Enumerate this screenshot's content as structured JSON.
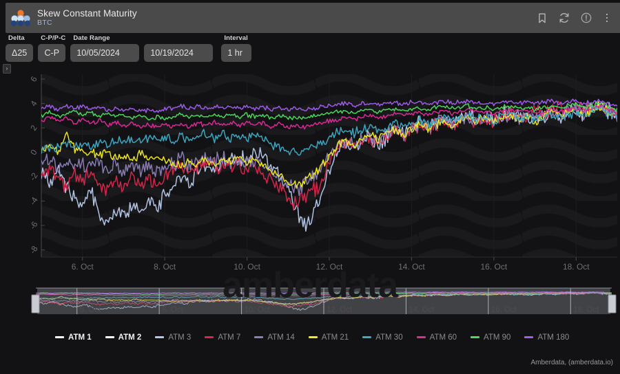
{
  "header": {
    "title": "Skew Constant Maturity",
    "subtitle": "BTC",
    "logo_icon": "amberdata-molecule-logo",
    "icons": [
      {
        "name": "bookmark-icon",
        "label": "Bookmark"
      },
      {
        "name": "refresh-icon",
        "label": "Refresh"
      },
      {
        "name": "info-icon",
        "label": "Info"
      },
      {
        "name": "kebab-menu-icon",
        "label": "More options"
      }
    ]
  },
  "controls": {
    "delta": {
      "label": "Delta",
      "value": "Δ25"
    },
    "cp": {
      "label": "C-P/P-C",
      "value": "C-P"
    },
    "date_range": {
      "label": "Date Range",
      "start": "10/05/2024",
      "end": "10/19/2024"
    },
    "interval": {
      "label": "Interval",
      "value": "1 hr"
    },
    "collapse_glyph": "›"
  },
  "credit": "Amberdata, (amberdata.io)",
  "watermark": "amberdata",
  "legend": [
    {
      "label": "ATM 1",
      "color": "#ffffff",
      "visible": false
    },
    {
      "label": "ATM 2",
      "color": "#ffffff",
      "visible": false
    },
    {
      "label": "ATM 3",
      "color": "#b7c8ea",
      "visible": true
    },
    {
      "label": "ATM 7",
      "color": "#d9264b",
      "visible": true
    },
    {
      "label": "ATM 14",
      "color": "#8c7fb8",
      "visible": true
    },
    {
      "label": "ATM 21",
      "color": "#f2ea1e",
      "visible": true
    },
    {
      "label": "ATM 30",
      "color": "#3fa9c4",
      "visible": true
    },
    {
      "label": "ATM 60",
      "color": "#e0299a",
      "visible": true
    },
    {
      "label": "ATM 90",
      "color": "#4ddb5e",
      "visible": true
    },
    {
      "label": "ATM 180",
      "color": "#a15df0",
      "visible": true
    }
  ],
  "chart_data": {
    "type": "line",
    "title": "Skew Constant Maturity",
    "subtitle": "BTC",
    "xlabel": "",
    "ylabel": "",
    "grid": true,
    "legend_position": "bottom",
    "yticks": [
      6,
      4,
      2,
      0,
      -2,
      -4,
      -6,
      -8
    ],
    "ylim": [
      -8.6,
      6.4
    ],
    "xticks": [
      "6. Oct",
      "8. Oct",
      "10. Oct",
      "12. Oct",
      "14. Oct",
      "16. Oct",
      "18. Oct"
    ],
    "xlim": [
      "10/05/2024",
      "10/19/2024"
    ],
    "x": [
      0,
      1,
      2,
      3,
      4,
      5,
      6,
      7,
      8,
      9,
      10,
      11,
      12,
      13,
      14,
      15,
      16,
      17,
      18,
      19,
      20,
      21,
      22,
      23,
      24,
      25,
      26,
      27,
      28,
      29,
      30,
      31,
      32,
      33,
      34,
      35,
      36,
      37,
      38,
      39,
      40,
      41,
      42,
      43,
      44,
      45,
      46,
      47,
      48,
      49,
      50,
      51,
      52,
      53,
      54,
      55,
      56,
      57,
      58,
      59,
      60,
      61,
      62,
      63,
      64,
      65,
      66,
      67,
      68,
      69,
      70
    ],
    "series": [
      {
        "name": "ATM 3",
        "color": "#b7c8ea",
        "visible": true,
        "values": [
          -1.6,
          -2.4,
          -1.1,
          -2.8,
          -3.6,
          -4.4,
          -3.1,
          -5.0,
          -5.9,
          -4.6,
          -5.3,
          -4.2,
          -5.0,
          -3.9,
          -4.6,
          -3.4,
          -2.6,
          -1.9,
          -2.5,
          -1.6,
          -0.9,
          -1.5,
          -1.0,
          -0.4,
          -0.8,
          -0.3,
          0.1,
          -0.5,
          -1.2,
          -2.0,
          -3.1,
          -4.6,
          -6.0,
          -5.2,
          -3.8,
          -1.4,
          0.2,
          0.9,
          0.4,
          1.0,
          1.3,
          0.7,
          1.4,
          2.0,
          1.5,
          2.1,
          2.5,
          2.0,
          2.6,
          2.9,
          2.4,
          2.9,
          3.2,
          2.7,
          3.0,
          2.6,
          3.0,
          3.3,
          2.8,
          3.1,
          2.7,
          3.0,
          3.3,
          2.9,
          3.2,
          3.5,
          3.1,
          3.6,
          3.9,
          3.4,
          3.1
        ]
      },
      {
        "name": "ATM 7",
        "color": "#d9264b",
        "visible": true,
        "values": [
          -1.9,
          -1.5,
          -2.2,
          -2.8,
          -1.9,
          -2.6,
          -1.8,
          -2.5,
          -3.2,
          -2.4,
          -3.0,
          -2.2,
          -2.9,
          -2.1,
          -2.7,
          -1.9,
          -1.5,
          -1.1,
          -1.6,
          -1.2,
          -0.8,
          -1.3,
          -0.9,
          -1.4,
          -1.0,
          -1.5,
          -1.1,
          -1.7,
          -2.3,
          -3.0,
          -3.6,
          -4.3,
          -3.7,
          -3.2,
          -2.4,
          -0.9,
          0.3,
          0.8,
          0.4,
          0.9,
          1.2,
          0.8,
          1.3,
          1.8,
          1.4,
          1.9,
          2.2,
          1.8,
          2.3,
          2.6,
          2.2,
          2.7,
          3.0,
          2.5,
          2.9,
          2.5,
          2.9,
          3.2,
          2.8,
          3.1,
          3.5,
          3.1,
          3.6,
          4.0,
          3.5,
          3.9,
          3.4,
          3.8,
          4.1,
          3.5,
          3.2
        ]
      },
      {
        "name": "ATM 14",
        "color": "#8c7fb8",
        "visible": true,
        "values": [
          -0.9,
          -0.5,
          -1.1,
          -0.7,
          -1.2,
          -0.8,
          -1.3,
          -0.9,
          -1.4,
          -1.0,
          -1.5,
          -1.1,
          -1.6,
          -1.2,
          -1.7,
          -1.2,
          -0.9,
          -0.6,
          -1.0,
          -0.7,
          -0.4,
          -0.8,
          -0.5,
          -0.9,
          -0.6,
          -1.0,
          -0.7,
          -1.2,
          -1.8,
          -2.3,
          -2.7,
          -3.1,
          -2.6,
          -2.2,
          -1.5,
          -0.5,
          0.4,
          0.9,
          0.5,
          1.0,
          1.3,
          0.9,
          1.4,
          1.8,
          1.4,
          1.9,
          2.2,
          1.8,
          2.3,
          2.6,
          2.2,
          2.6,
          2.9,
          2.5,
          2.8,
          2.4,
          2.8,
          3.1,
          2.7,
          3.0,
          2.6,
          3.0,
          3.3,
          2.9,
          3.2,
          3.5,
          3.1,
          3.5,
          3.8,
          3.3,
          3.0
        ]
      },
      {
        "name": "ATM 21",
        "color": "#f2ea1e",
        "visible": true,
        "values": [
          0.2,
          0.6,
          0.1,
          1.4,
          0.3,
          -0.1,
          0.2,
          -0.3,
          0.0,
          -0.4,
          -0.1,
          -0.5,
          -0.2,
          -0.6,
          -0.3,
          -0.7,
          -0.9,
          -1.2,
          -0.8,
          -1.1,
          -0.7,
          -1.0,
          -0.6,
          -0.9,
          -0.5,
          -0.9,
          -0.5,
          -1.1,
          -1.6,
          -2.0,
          -2.4,
          -2.7,
          -2.3,
          -1.9,
          -1.3,
          -0.3,
          0.5,
          1.0,
          0.6,
          1.1,
          1.4,
          1.0,
          1.5,
          1.9,
          1.5,
          2.0,
          2.3,
          1.9,
          2.3,
          2.6,
          2.2,
          2.6,
          2.9,
          2.5,
          2.8,
          2.5,
          2.8,
          3.1,
          2.7,
          3.0,
          2.6,
          3.0,
          3.3,
          2.9,
          3.2,
          3.5,
          3.1,
          3.5,
          3.8,
          3.3,
          3.0
        ]
      },
      {
        "name": "ATM 30",
        "color": "#3fa9c4",
        "visible": true,
        "values": [
          0.2,
          0.5,
          0.3,
          0.7,
          0.4,
          0.8,
          0.5,
          0.9,
          0.6,
          1.0,
          0.7,
          1.1,
          0.8,
          1.2,
          0.9,
          1.2,
          1.0,
          1.3,
          1.0,
          1.3,
          1.5,
          1.2,
          1.5,
          1.2,
          1.5,
          1.2,
          1.5,
          1.1,
          0.7,
          0.4,
          0.1,
          -0.2,
          0.1,
          0.4,
          0.8,
          1.3,
          1.6,
          1.9,
          1.6,
          1.9,
          2.1,
          1.8,
          2.1,
          2.4,
          2.1,
          2.4,
          2.6,
          2.3,
          2.6,
          2.8,
          2.5,
          2.8,
          3.0,
          2.7,
          2.9,
          2.6,
          2.9,
          3.1,
          2.8,
          3.0,
          2.7,
          3.0,
          3.2,
          2.9,
          3.1,
          3.4,
          3.1,
          3.4,
          3.6,
          3.2,
          3.0
        ]
      },
      {
        "name": "ATM 60",
        "color": "#e0299a",
        "visible": true,
        "values": [
          2.6,
          2.9,
          2.5,
          2.8,
          2.4,
          2.7,
          2.3,
          2.6,
          2.2,
          2.5,
          2.1,
          2.4,
          2.0,
          2.3,
          2.0,
          2.3,
          2.1,
          2.4,
          2.1,
          2.4,
          2.2,
          2.5,
          2.2,
          2.5,
          2.2,
          2.5,
          2.2,
          2.4,
          2.1,
          2.3,
          2.0,
          2.2,
          2.0,
          2.2,
          2.4,
          2.6,
          2.7,
          2.9,
          2.7,
          2.9,
          3.0,
          2.8,
          3.0,
          3.2,
          3.0,
          3.2,
          3.3,
          3.1,
          3.3,
          3.4,
          3.2,
          3.4,
          3.5,
          3.3,
          3.4,
          3.2,
          3.4,
          3.5,
          3.3,
          3.4,
          3.2,
          3.4,
          3.5,
          3.3,
          3.5,
          3.6,
          3.4,
          3.6,
          3.8,
          3.4,
          3.2
        ]
      },
      {
        "name": "ATM 90",
        "color": "#4ddb5e",
        "visible": true,
        "values": [
          3.0,
          3.3,
          2.9,
          3.2,
          3.4,
          3.1,
          3.3,
          3.0,
          3.2,
          2.9,
          3.1,
          2.8,
          3.0,
          2.7,
          2.9,
          2.7,
          2.9,
          3.1,
          2.9,
          3.1,
          2.9,
          3.1,
          2.9,
          3.1,
          2.9,
          3.1,
          2.9,
          3.0,
          2.8,
          3.0,
          2.8,
          2.9,
          2.8,
          3.0,
          3.1,
          3.2,
          3.3,
          3.4,
          3.2,
          3.4,
          3.5,
          3.3,
          3.5,
          3.6,
          3.4,
          3.6,
          3.7,
          3.5,
          3.7,
          3.8,
          3.6,
          3.7,
          3.8,
          3.6,
          3.7,
          3.5,
          3.7,
          3.8,
          3.6,
          3.7,
          3.5,
          3.7,
          3.8,
          3.6,
          3.8,
          3.9,
          3.7,
          3.9,
          4.0,
          3.7,
          3.5
        ]
      },
      {
        "name": "ATM 180",
        "color": "#a15df0",
        "visible": true,
        "values": [
          3.6,
          3.8,
          3.5,
          3.8,
          3.6,
          3.8,
          3.5,
          3.7,
          3.4,
          3.6,
          3.4,
          3.6,
          3.3,
          3.5,
          3.3,
          3.5,
          3.6,
          3.8,
          3.6,
          3.8,
          3.6,
          3.8,
          3.6,
          3.8,
          3.6,
          3.8,
          3.6,
          3.7,
          3.5,
          3.7,
          3.5,
          3.6,
          3.5,
          3.6,
          3.7,
          3.8,
          3.9,
          4.0,
          3.8,
          4.0,
          4.0,
          3.9,
          4.0,
          4.1,
          3.9,
          4.1,
          4.1,
          4.0,
          4.1,
          4.2,
          4.0,
          4.1,
          4.2,
          4.0,
          4.1,
          3.9,
          4.1,
          4.2,
          4.0,
          4.1,
          3.9,
          4.1,
          4.2,
          4.0,
          4.1,
          4.2,
          4.0,
          4.2,
          4.3,
          4.0,
          3.8
        ]
      }
    ]
  },
  "navigator": {
    "xticks": [
      "6. Oct",
      "8. Oct",
      "10. Oct",
      "12. Oct",
      "14. Oct",
      "16. Oct",
      "18. Oct"
    ],
    "handle_left_label": "navigator-left-handle",
    "handle_right_label": "navigator-right-handle"
  }
}
